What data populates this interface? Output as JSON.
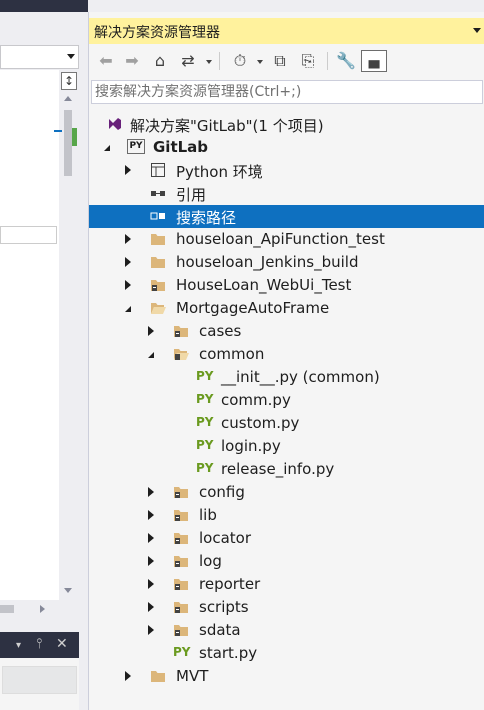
{
  "explorer": {
    "title": "解决方案资源管理器",
    "search_placeholder": "搜索解决方案资源管理器(Ctrl+;)"
  },
  "tree": {
    "solution": "解决方案\"GitLab\"(1 个项目)",
    "project": "GitLab",
    "python_env": "Python 环境",
    "references": "引用",
    "search_paths": "搜索路径",
    "folders_top": [
      "houseloan_ApiFunction_test",
      "houseloan_Jenkins_build",
      "HouseLoan_WebUi_Test"
    ],
    "mortgage": "MortgageAutoFrame",
    "cases": "cases",
    "common": "common",
    "common_files": [
      "__init__.py (common)",
      "comm.py",
      "custom.py",
      "login.py",
      "release_info.py"
    ],
    "subfolders": [
      "config",
      "lib",
      "locator",
      "log",
      "reporter",
      "scripts",
      "sdata"
    ],
    "start_file": "start.py",
    "mvt": "MVT"
  },
  "icons": {
    "py_label": "PY",
    "accent": "#0e70c0",
    "title_bg": "#fff29d"
  }
}
